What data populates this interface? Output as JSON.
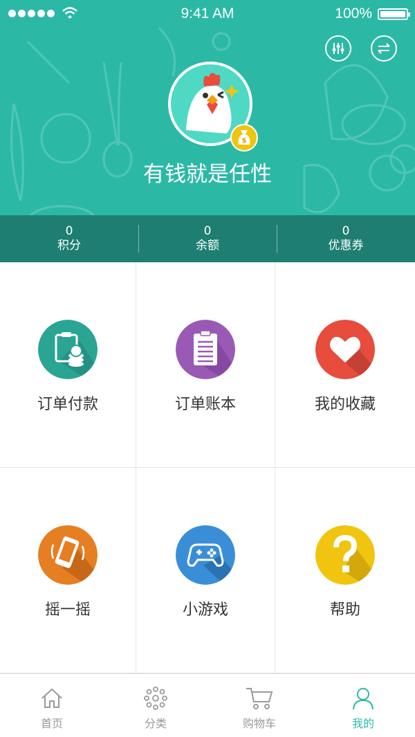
{
  "status_bar": {
    "time": "9:41 AM",
    "battery": "100%"
  },
  "header": {
    "username": "有钱就是任性"
  },
  "stats": [
    {
      "value": "0",
      "label": "积分"
    },
    {
      "value": "0",
      "label": "余额"
    },
    {
      "value": "0",
      "label": "优惠券"
    }
  ],
  "grid": [
    {
      "label": "订单付款",
      "icon": "clipboard-coins-icon",
      "color": "#2aa593"
    },
    {
      "label": "订单账本",
      "icon": "clipboard-list-icon",
      "color": "#9b59b6"
    },
    {
      "label": "我的收藏",
      "icon": "heart-icon",
      "color": "#e74c3c"
    },
    {
      "label": "摇一摇",
      "icon": "shake-phone-icon",
      "color": "#e67e22"
    },
    {
      "label": "小游戏",
      "icon": "gamepad-icon",
      "color": "#3a8ed8"
    },
    {
      "label": "帮助",
      "icon": "question-icon",
      "color": "#f1c40f"
    }
  ],
  "tabbar": [
    {
      "label": "首页",
      "icon": "home-icon"
    },
    {
      "label": "分类",
      "icon": "category-icon"
    },
    {
      "label": "购物车",
      "icon": "cart-icon"
    },
    {
      "label": "我的",
      "icon": "user-icon",
      "active": true
    }
  ],
  "colors": {
    "brand": "#2bb9a6",
    "stats_bar": "#1e7e71"
  }
}
